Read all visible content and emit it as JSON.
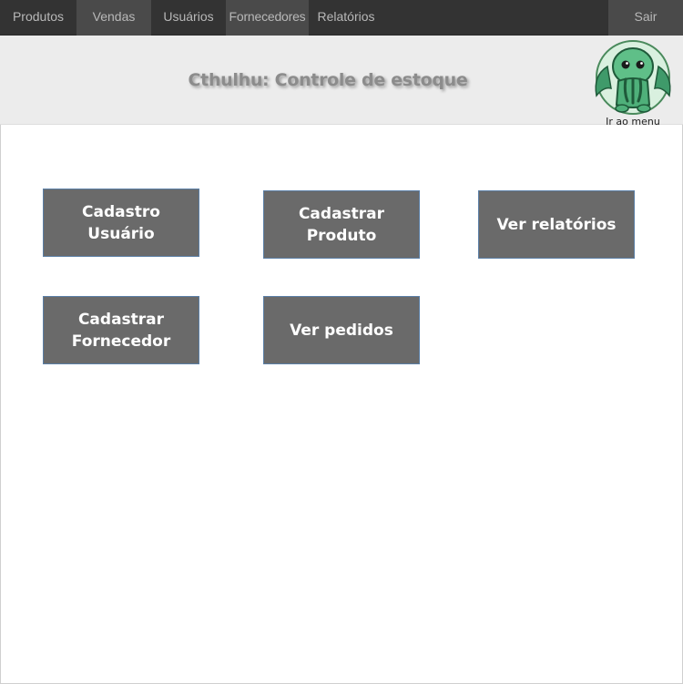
{
  "nav": {
    "items": [
      {
        "label": "Produtos"
      },
      {
        "label": "Vendas"
      },
      {
        "label": "Usuários"
      },
      {
        "label": "Fornecedores"
      },
      {
        "label": "Relatórios"
      }
    ],
    "logout_label": "Sair"
  },
  "header": {
    "title": "Cthulhu: Controle de estoque",
    "logo_caption": "Ir ao menu",
    "logo_icon": "cthulhu-mascot-icon"
  },
  "menu": {
    "buttons": [
      {
        "label": "Cadastro Usuário"
      },
      {
        "label": "Cadastrar Produto"
      },
      {
        "label": "Ver relatórios"
      },
      {
        "label": "Cadastrar Fornecedor"
      },
      {
        "label": "Ver pedidos"
      }
    ]
  },
  "colors": {
    "nav_background": "#333333",
    "header_background": "#ececec",
    "button_background": "#6a6a6a",
    "button_border": "#5b7fa6"
  }
}
